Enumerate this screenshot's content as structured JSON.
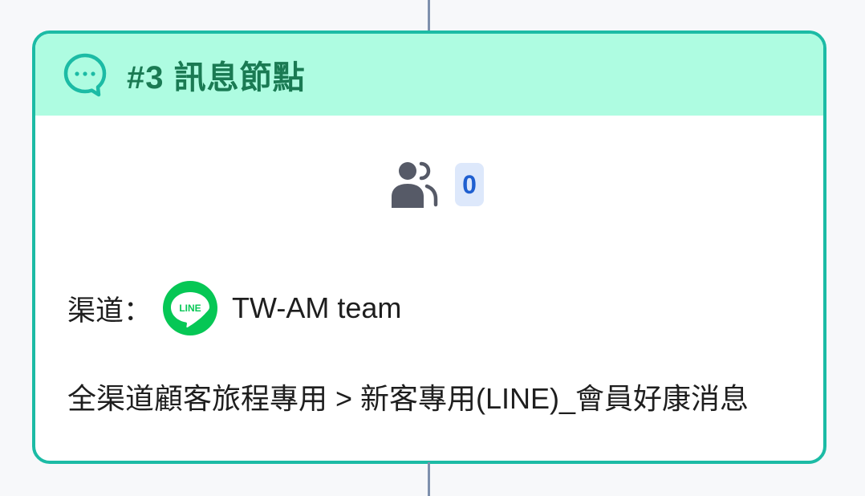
{
  "node": {
    "title": "#3 訊息節點",
    "audience_count": "0",
    "channel_label": "渠道：",
    "channel_name": "TW-AM team",
    "channel_logo_text": "LINE",
    "journey_path": "全渠道顧客旅程專用 > 新客專用(LINE)_會員好康消息"
  },
  "icons": {
    "header": "message-bubble-icon",
    "audience": "users-group-icon",
    "channel": "line-logo-icon"
  },
  "colors": {
    "border": "#1cbba5",
    "header_bg": "#aefce1",
    "title": "#1a7a53",
    "badge_bg": "#dde8fb",
    "badge_text": "#1f5fd0",
    "line_green": "#06c755",
    "connector": "#7e90ad"
  }
}
